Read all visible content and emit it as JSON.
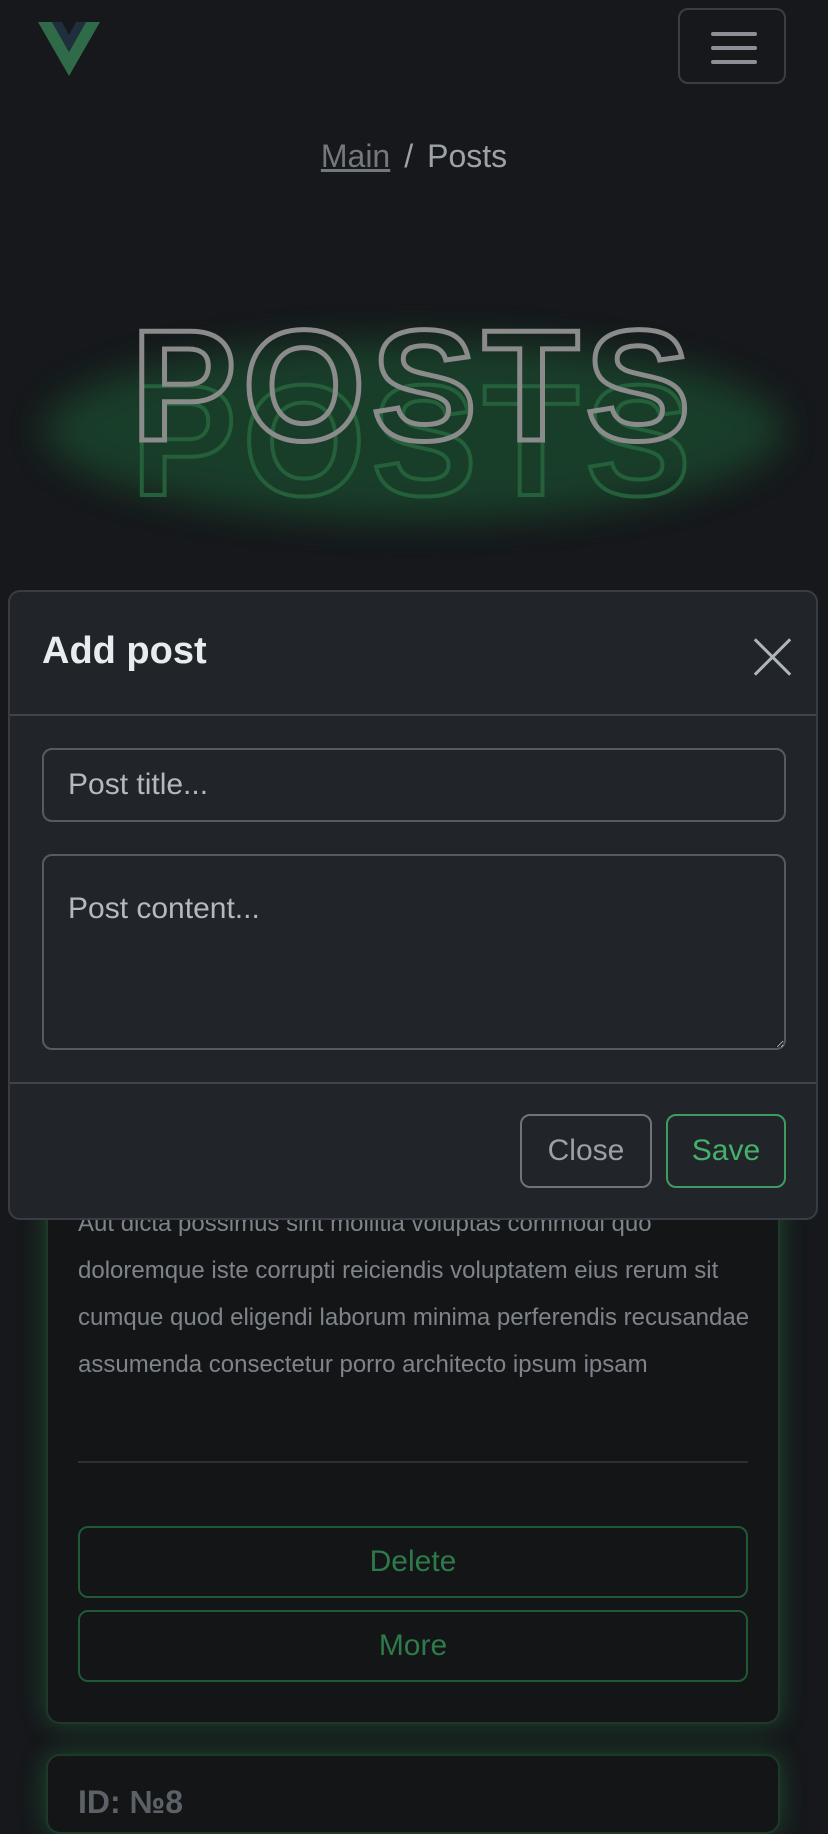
{
  "navbar": {
    "logo_icon": "vue-logo-icon",
    "menu_icon": "hamburger-menu-icon"
  },
  "breadcrumb": {
    "items": [
      "Main",
      "Posts"
    ],
    "separator": "/"
  },
  "hero": {
    "title": "POSTS",
    "colors": {
      "outline": "#8b8b8b",
      "reflection": "#24603a",
      "glow": "#1c6a3a"
    }
  },
  "background_post": {
    "body": "Aut dicta possimus sint mollitia voluptas commodi quo doloremque iste corrupti reiciendis voluptatem eius rerum sit cumque quod eligendi laborum minima perferendis recusandae assumenda consectetur porro architecto ipsum ipsam",
    "delete_label": "Delete",
    "more_label": "More"
  },
  "next_post": {
    "id_label": "ID: №8"
  },
  "modal": {
    "title": "Add post",
    "close_icon": "close-icon",
    "title_placeholder": "Post title...",
    "content_placeholder": "Post content...",
    "close_label": "Close",
    "save_label": "Save",
    "colors": {
      "accent": "#45b06b",
      "surface": "#212529",
      "page": "#16181b"
    }
  }
}
